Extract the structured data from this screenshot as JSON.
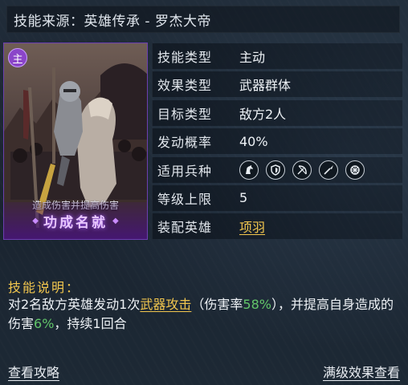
{
  "header": {
    "source_text": "技能来源：英雄传承 - 罗杰大帝"
  },
  "card": {
    "badge": "主",
    "caption": "造成伤害并提高伤害",
    "title": "功成名就",
    "accent_color": "#8b45c9"
  },
  "attributes": [
    {
      "label": "技能类型",
      "value": "主动"
    },
    {
      "label": "效果类型",
      "value": "武器群体"
    },
    {
      "label": "目标类型",
      "value": "敌方2人"
    },
    {
      "label": "发动概率",
      "value": "40%"
    },
    {
      "label": "适用兵种",
      "icons": [
        "horse-icon",
        "shield-icon",
        "bow-icon",
        "spear-icon",
        "wheel-icon"
      ]
    },
    {
      "label": "等级上限",
      "value": "5"
    },
    {
      "label": "装配英雄",
      "value": "项羽"
    }
  ],
  "description": {
    "title": "技能说明：",
    "text_1": "对2名敌方英雄发动1次",
    "link": "武器攻击",
    "text_2": "（伤害率",
    "rate": "58%",
    "text_3": "），并提高自身造成的伤害",
    "bonus": "6%",
    "text_4": "，持续1回合"
  },
  "footer": {
    "left_link": "查看攻略",
    "right_link": "满级效果查看"
  },
  "colors": {
    "gold": "#f2c64e",
    "green": "#62c56a",
    "purple": "#8b45c9"
  }
}
